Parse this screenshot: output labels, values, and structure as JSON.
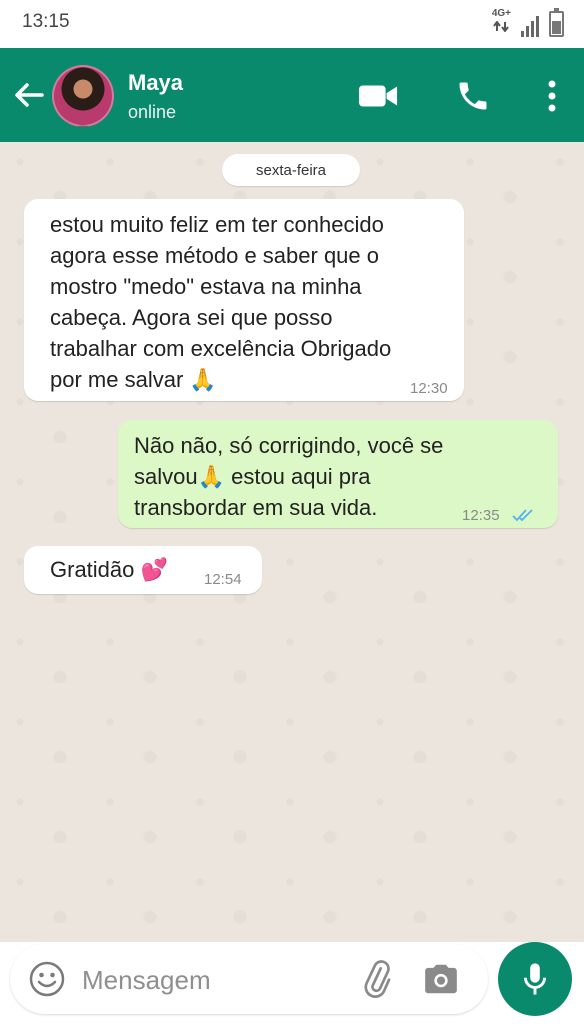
{
  "status_bar": {
    "time": "13:15",
    "network": "4G+"
  },
  "header": {
    "contact_name": "Maya",
    "contact_status": "online",
    "icons": [
      "back-arrow-icon",
      "video-call-icon",
      "phone-icon",
      "more-vert-icon"
    ],
    "color": "#0a8a6c"
  },
  "chat": {
    "date_label": "sexta-feira",
    "messages": [
      {
        "direction": "in",
        "lines": [
          "estou muito feliz em ter conhecido",
          "agora esse método e saber que o",
          "mostro \"medo\" estava na minha",
          "cabeça. Agora sei que posso",
          "trabalhar com excelência Obrigado",
          "por me salvar 🙏"
        ],
        "time": "12:30"
      },
      {
        "direction": "out",
        "lines": [
          "Não não, só corrigindo, você se",
          "salvou🙏 estou aqui pra",
          "transbordar em sua vida."
        ],
        "time": "12:35",
        "status": "read"
      },
      {
        "direction": "in",
        "lines": [
          "Gratidão 💕"
        ],
        "time": "12:54"
      }
    ],
    "bubble_colors": {
      "incoming": "#ffffff",
      "outgoing": "#dcf8c6",
      "read_ticks": "#4fb6ec"
    }
  },
  "composer": {
    "placeholder": "Mensagem",
    "value": "",
    "icons": [
      "emoji-icon",
      "attach-icon",
      "camera-icon",
      "mic-icon"
    ]
  }
}
